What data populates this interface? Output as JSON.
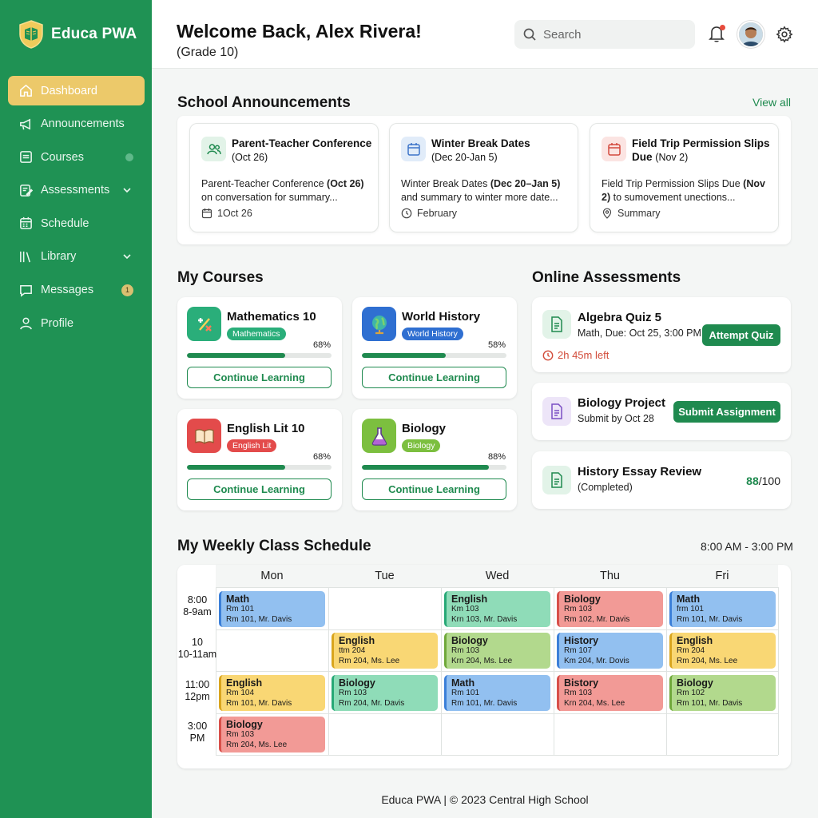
{
  "app": {
    "name": "Educa PWA"
  },
  "sidebar": {
    "items": [
      {
        "label": "Dashboard",
        "icon": "home-icon",
        "active": true
      },
      {
        "label": "Announcements",
        "icon": "megaphone-icon"
      },
      {
        "label": "Courses",
        "icon": "book-icon"
      },
      {
        "label": "Assessments",
        "icon": "clipboard-icon"
      },
      {
        "label": "Schedule",
        "icon": "calendar-icon"
      },
      {
        "label": "Library",
        "icon": "library-icon"
      },
      {
        "label": "Messages",
        "icon": "chat-icon",
        "badge": "1"
      },
      {
        "label": "Profile",
        "icon": "user-icon"
      }
    ]
  },
  "header": {
    "welcome": "Welcome Back, Alex Rivera!",
    "grade": "(Grade 10)",
    "search_placeholder": "Search"
  },
  "announcements": {
    "title": "School Announcements",
    "view_all": "View all",
    "cards": [
      {
        "title": "Parent-Teacher Conference",
        "sub": "(Oct 26)",
        "body_a": "Parent-Teacher Conference ",
        "body_b": "(Oct 26)",
        "body_c": " on conversation for summary...",
        "foot": "1Oct 26",
        "icon": "users-icon"
      },
      {
        "title": "Winter Break Dates",
        "sub": "(Dec 20-Jan 5)",
        "body_a": "Winter Break Dates ",
        "body_b": "(Dec 20–Jan 5)",
        "body_c": " and summary to winter more date...",
        "foot": "February",
        "icon": "calendar-icon"
      },
      {
        "title": "Field Trip Permission Slips Due",
        "sub": "(Nov 2)",
        "body_a": "Field Trip Permission Slips Due ",
        "body_b": "(Nov 2)",
        "body_c": " to sumovement unections...",
        "foot": "Summary",
        "icon": "calendar-icon"
      }
    ]
  },
  "courses": {
    "title": "My Courses",
    "items": [
      {
        "name": "Mathematics 10",
        "tag": "Mathematics",
        "progress": 68,
        "progress_label": "68%",
        "button": "Continue Learning"
      },
      {
        "name": "World History",
        "tag": "World History",
        "progress": 58,
        "progress_label": "58%",
        "button": "Continue Learning"
      },
      {
        "name": "English Lit 10",
        "tag": "English Lit",
        "progress": 68,
        "progress_label": "68%",
        "button": "Continue Learning"
      },
      {
        "name": "Biology",
        "tag": "Biology",
        "progress": 88,
        "progress_label": "88%",
        "button": "Continue Learning"
      }
    ]
  },
  "assessments": {
    "title": "Online Assessments",
    "items": [
      {
        "name": "Algebra Quiz 5",
        "sub": "Math, Due: Oct 25, 3:00 PM",
        "action": "Attempt Quiz",
        "timer": "2h 45m left"
      },
      {
        "name": "Biology Project",
        "sub": "Submit by Oct 28",
        "action": "Submit Assignment"
      },
      {
        "name": "History Essay Review",
        "sub": "(Completed)",
        "score": "88",
        "score_total": "/100"
      }
    ]
  },
  "schedule": {
    "title": "My Weekly Class Schedule",
    "range": "8:00 AM - 3:00 PM",
    "days": [
      "Mon",
      "Tue",
      "Wed",
      "Thu",
      "Fri"
    ],
    "times": [
      {
        "a": "8:00",
        "b": "8-9am"
      },
      {
        "a": "10",
        "b": "10-11am"
      },
      {
        "a": "11:00",
        "b": "12pm"
      },
      {
        "a": "3:00",
        "b": "PM"
      }
    ],
    "classes": [
      {
        "day": 0,
        "row": 0,
        "title": "Math",
        "room": "Rm 101",
        "detail": "Rm 101, Mr. Davis",
        "color": "blue"
      },
      {
        "day": 2,
        "row": 0,
        "title": "English",
        "room": "Km 103",
        "detail": "Krn 103, Mr. Davis",
        "color": "teal"
      },
      {
        "day": 3,
        "row": 0,
        "title": "Biology",
        "room": "Rm 103",
        "detail": "Rm 102, Mr. Davis",
        "color": "red"
      },
      {
        "day": 4,
        "row": 0,
        "title": "Math",
        "room": "frm 101",
        "detail": "Rm 101, Mr. Davis",
        "color": "blue"
      },
      {
        "day": 1,
        "row": 1,
        "title": "English",
        "room": "ttm 204",
        "detail": "Rm 204, Ms. Lee",
        "color": "yellow"
      },
      {
        "day": 2,
        "row": 1,
        "title": "Biology",
        "room": "Rm 103",
        "detail": "Krn 204, Ms. Lee",
        "color": "green"
      },
      {
        "day": 3,
        "row": 1,
        "title": "History",
        "room": "Rm 107",
        "detail": "Km 204, Mr. Dovis",
        "color": "blue"
      },
      {
        "day": 4,
        "row": 1,
        "title": "English",
        "room": "Rm 204",
        "detail": "Rm 204, Ms. Lee",
        "color": "yellow"
      },
      {
        "day": 0,
        "row": 2,
        "title": "English",
        "room": "Rm 104",
        "detail": "Rm 101, Mr. Davis",
        "color": "yellow"
      },
      {
        "day": 1,
        "row": 2,
        "title": "Biology",
        "room": "Rm 103",
        "detail": "Rm 204, Mr. Davis",
        "color": "teal"
      },
      {
        "day": 2,
        "row": 2,
        "title": "Math",
        "room": "Rm 101",
        "detail": "Rm 101, Mr. Davis",
        "color": "blue"
      },
      {
        "day": 3,
        "row": 2,
        "title": "Bistory",
        "room": "Rm 103",
        "detail": "Krn 204, Ms. Lee",
        "color": "red"
      },
      {
        "day": 4,
        "row": 2,
        "title": "Biology",
        "room": "Rm 102",
        "detail": "Rm 101, Mr. Davis",
        "color": "green"
      },
      {
        "day": 0,
        "row": 3,
        "title": "Biology",
        "room": "Rm 103",
        "detail": "Rm 204, Ms. Lee",
        "color": "red"
      }
    ]
  },
  "palette": {
    "accent": "#1f8a4f",
    "sidebar": "#1f9254",
    "active_nav": "#ecc96a",
    "blue": "#92c0f0",
    "teal": "#8fdcb8",
    "red": "#f29a96",
    "yellow": "#f9d774",
    "green": "#b2d98d"
  },
  "footer": "Educa PWA | © 2023 Central High School"
}
